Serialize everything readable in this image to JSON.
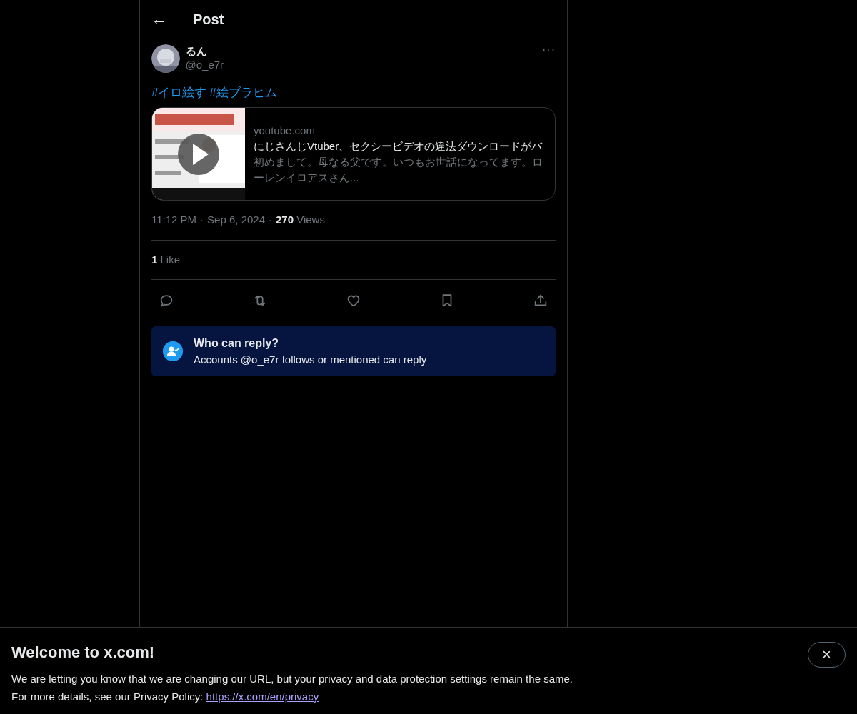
{
  "header": {
    "back": "←",
    "title": "Post"
  },
  "author": {
    "name": "るん",
    "handle": "@o_e7r"
  },
  "more": "···",
  "hashtags": [
    "#イロ絵す",
    "#絵ブラヒム"
  ],
  "link_card": {
    "domain": "youtube.com",
    "title": "にじさんじVtuber、セクシービデオの違法ダウンロードがバ",
    "description": "初めまして。母なる父です。いつもお世話になってます。ローレンイロアスさん..."
  },
  "meta": {
    "time": "11:12 PM",
    "separator_1": "·",
    "date": "Sep 6, 2024",
    "separator_2": "·",
    "views_count": "270",
    "views_label": "Views"
  },
  "likes": {
    "count": "1",
    "label": "Like"
  },
  "actions": [
    {
      "kind": "reply"
    },
    {
      "kind": "repost"
    },
    {
      "kind": "like"
    },
    {
      "kind": "bookmark"
    },
    {
      "kind": "share"
    }
  ],
  "reply_notice": {
    "title": "Who can reply?",
    "text": "Accounts @o_e7r follows or mentioned can reply"
  },
  "banner": {
    "title": "Welcome to x.com!",
    "line1": "We are letting you know that we are changing our URL, but your privacy and data protection settings remain the same.",
    "line2_prefix": "For more details, see our Privacy Policy:",
    "link": "https://x.com/en/privacy",
    "close": "×"
  }
}
